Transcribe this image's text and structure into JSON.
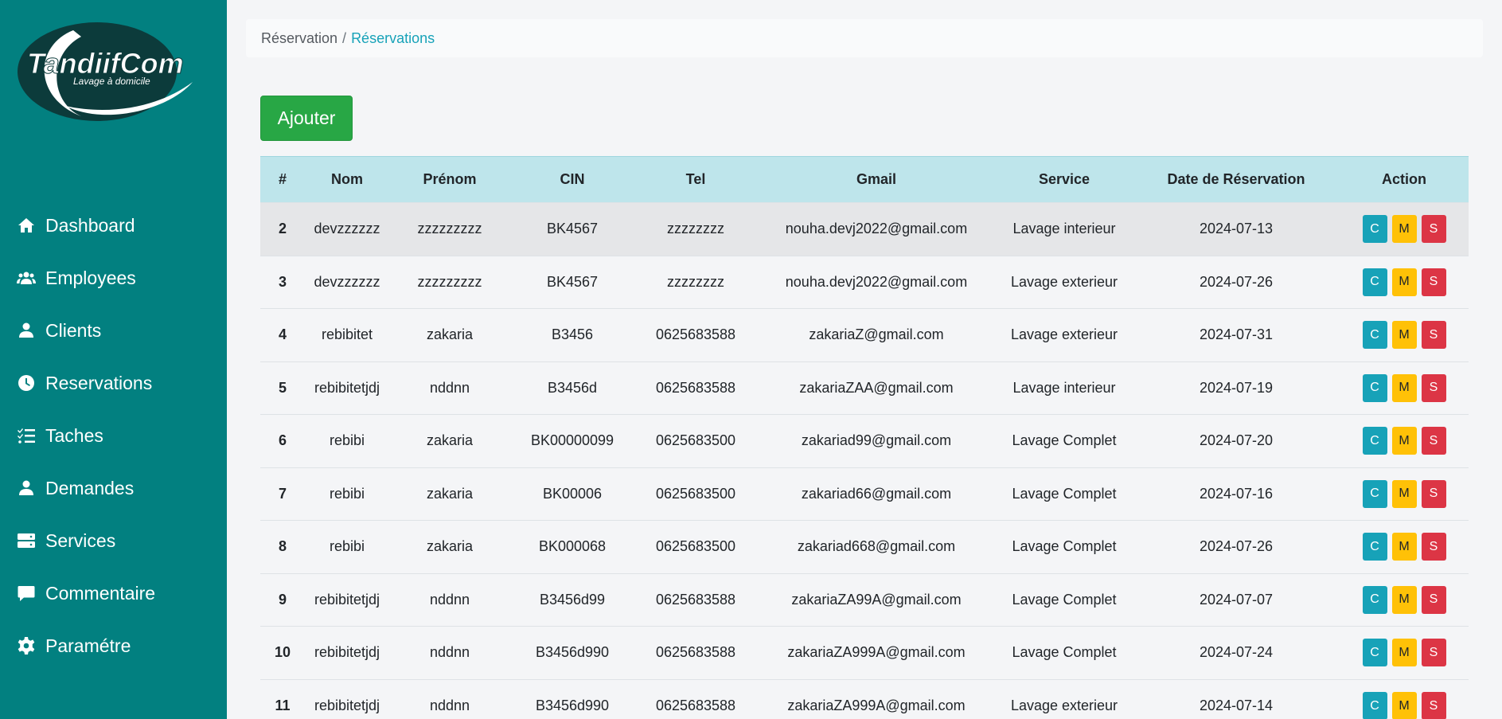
{
  "brand": {
    "name": "TandiifCom",
    "tagline": "Lavage à domicile"
  },
  "sidebar": {
    "items": [
      {
        "label": "Dashboard",
        "icon": "home-icon"
      },
      {
        "label": "Employees",
        "icon": "users-icon"
      },
      {
        "label": "Clients",
        "icon": "user-icon"
      },
      {
        "label": "Reservations",
        "icon": "clock-icon"
      },
      {
        "label": "Taches",
        "icon": "tasks-icon"
      },
      {
        "label": "Demandes",
        "icon": "user-icon"
      },
      {
        "label": "Services",
        "icon": "server-icon"
      },
      {
        "label": "Commentaire",
        "icon": "comment-icon"
      },
      {
        "label": "Paramétre",
        "icon": "gear-icon"
      }
    ]
  },
  "breadcrumb": {
    "parent": "Réservation",
    "separator": "/",
    "current": "Réservations"
  },
  "add_button": "Ajouter",
  "table": {
    "headers": [
      "#",
      "Nom",
      "Prénom",
      "CIN",
      "Tel",
      "Gmail",
      "Service",
      "Date de Réservation",
      "Action"
    ],
    "actions": {
      "c": "C",
      "m": "M",
      "s": "S"
    },
    "rows": [
      [
        "2",
        "devzzzzzz",
        "zzzzzzzzz",
        "BK4567",
        "zzzzzzzz",
        "nouha.devj2022@gmail.com",
        "Lavage interieur",
        "2024-07-13"
      ],
      [
        "3",
        "devzzzzzz",
        "zzzzzzzzz",
        "BK4567",
        "zzzzzzzz",
        "nouha.devj2022@gmail.com",
        "Lavage exterieur",
        "2024-07-26"
      ],
      [
        "4",
        "rebibitet",
        "zakaria",
        "B3456",
        "0625683588",
        "zakariaZ@gmail.com",
        "Lavage exterieur",
        "2024-07-31"
      ],
      [
        "5",
        "rebibitetjdj",
        "nddnn",
        "B3456d",
        "0625683588",
        "zakariaZAA@gmail.com",
        "Lavage interieur",
        "2024-07-19"
      ],
      [
        "6",
        "rebibi",
        "zakaria",
        "BK00000099",
        "0625683500",
        "zakariad99@gmail.com",
        "Lavage Complet",
        "2024-07-20"
      ],
      [
        "7",
        "rebibi",
        "zakaria",
        "BK00006",
        "0625683500",
        "zakariad66@gmail.com",
        "Lavage Complet",
        "2024-07-16"
      ],
      [
        "8",
        "rebibi",
        "zakaria",
        "BK000068",
        "0625683500",
        "zakariad668@gmail.com",
        "Lavage Complet",
        "2024-07-26"
      ],
      [
        "9",
        "rebibitetjdj",
        "nddnn",
        "B3456d99",
        "0625683588",
        "zakariaZA99A@gmail.com",
        "Lavage Complet",
        "2024-07-07"
      ],
      [
        "10",
        "rebibitetjdj",
        "nddnn",
        "B3456d990",
        "0625683588",
        "zakariaZA999A@gmail.com",
        "Lavage Complet",
        "2024-07-24"
      ],
      [
        "11",
        "rebibitetjdj",
        "nddnn",
        "B3456d990",
        "0625683588",
        "zakariaZA999A@gmail.com",
        "Lavage exterieur",
        "2024-07-14"
      ]
    ]
  }
}
